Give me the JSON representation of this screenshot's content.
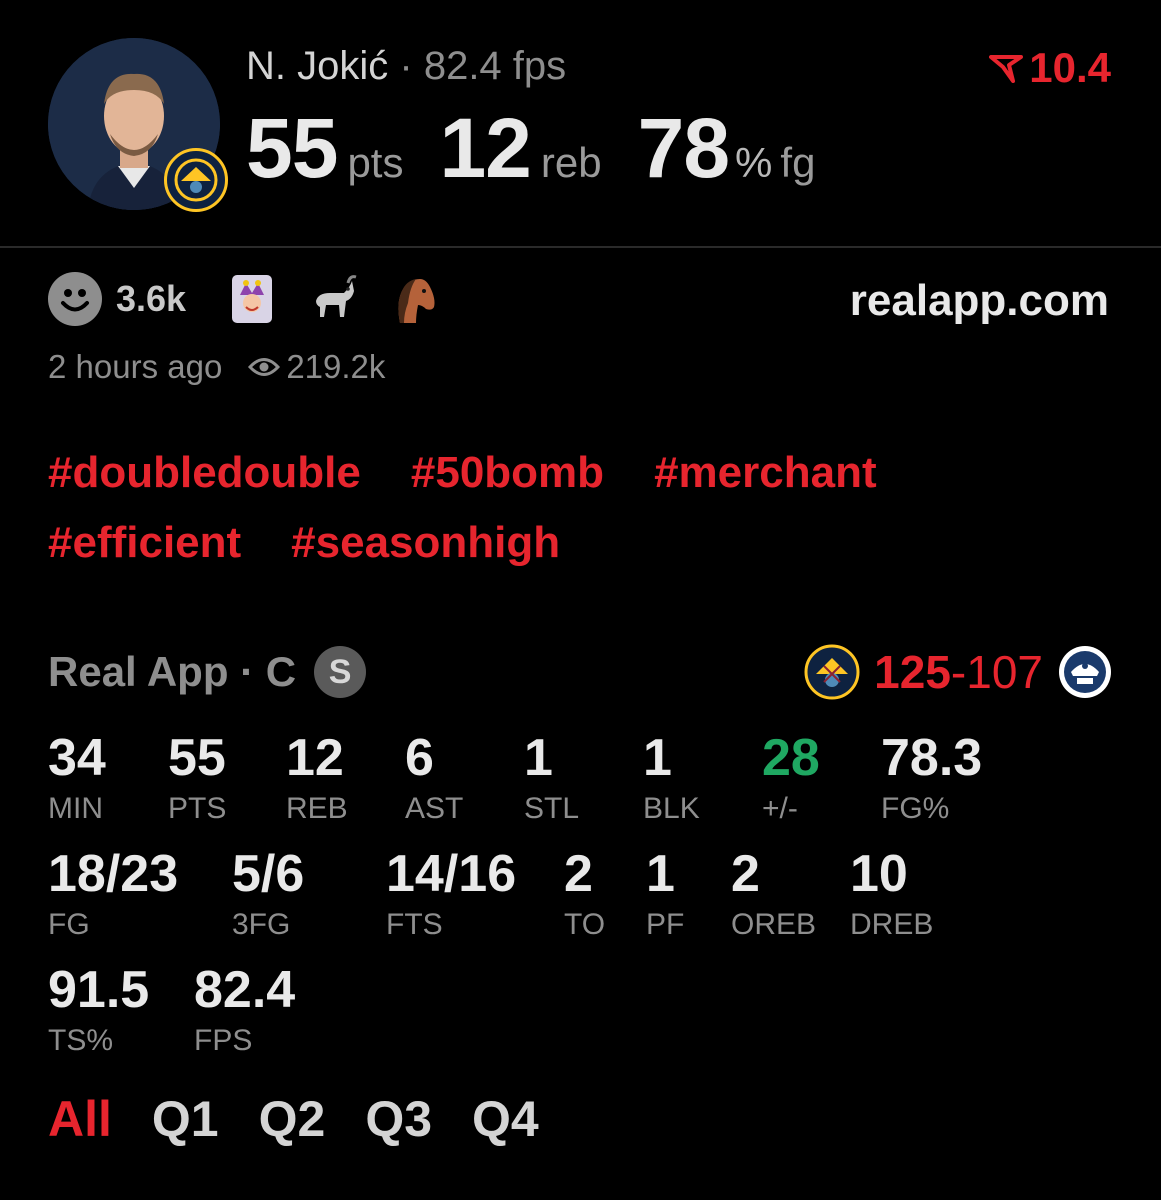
{
  "header": {
    "player_name": "N. Jokić",
    "separator": "·",
    "fps_label": "82.4 fps",
    "rating_value": "10.4",
    "stats": [
      {
        "value": "55",
        "unit": "pts"
      },
      {
        "value": "12",
        "unit": "reb"
      },
      {
        "value": "78",
        "pct": "%",
        "unit": "fg"
      }
    ]
  },
  "reactions": {
    "count": "3.6k",
    "emojis": [
      "joker-card-emoji",
      "goat-emoji",
      "horse-emoji"
    ],
    "site": "realapp.com"
  },
  "meta": {
    "time_ago": "2 hours ago",
    "views": "219.2k"
  },
  "hashtags": [
    "#doubledouble",
    "#50bomb",
    "#merchant",
    "#efficient",
    "#seasonhigh"
  ],
  "game": {
    "source": "Real App · C",
    "badge": "S",
    "score_home": "125",
    "score_sep": "-",
    "score_away": "107",
    "stats": [
      {
        "value": "34",
        "label": "MIN"
      },
      {
        "value": "55",
        "label": "PTS"
      },
      {
        "value": "12",
        "label": "REB"
      },
      {
        "value": "6",
        "label": "AST"
      },
      {
        "value": "1",
        "label": "STL"
      },
      {
        "value": "1",
        "label": "BLK"
      },
      {
        "value": "28",
        "label": "+/-"
      },
      {
        "value": "78.3",
        "label": "FG%"
      },
      {
        "value": "18/23",
        "label": "FG"
      },
      {
        "value": "5/6",
        "label": "3FG"
      },
      {
        "value": "14/16",
        "label": "FTS"
      },
      {
        "value": "2",
        "label": "TO"
      },
      {
        "value": "1",
        "label": "PF"
      },
      {
        "value": "2",
        "label": "OREB"
      },
      {
        "value": "10",
        "label": "DREB"
      },
      {
        "value": "91.5",
        "label": "TS%"
      },
      {
        "value": "82.4",
        "label": "FPS"
      }
    ]
  },
  "tabs": [
    "All",
    "Q1",
    "Q2",
    "Q3",
    "Q4"
  ],
  "colors": {
    "accent": "#e7252e",
    "positive": "#1fa862",
    "muted": "#8e8e8e",
    "background": "#000000"
  }
}
